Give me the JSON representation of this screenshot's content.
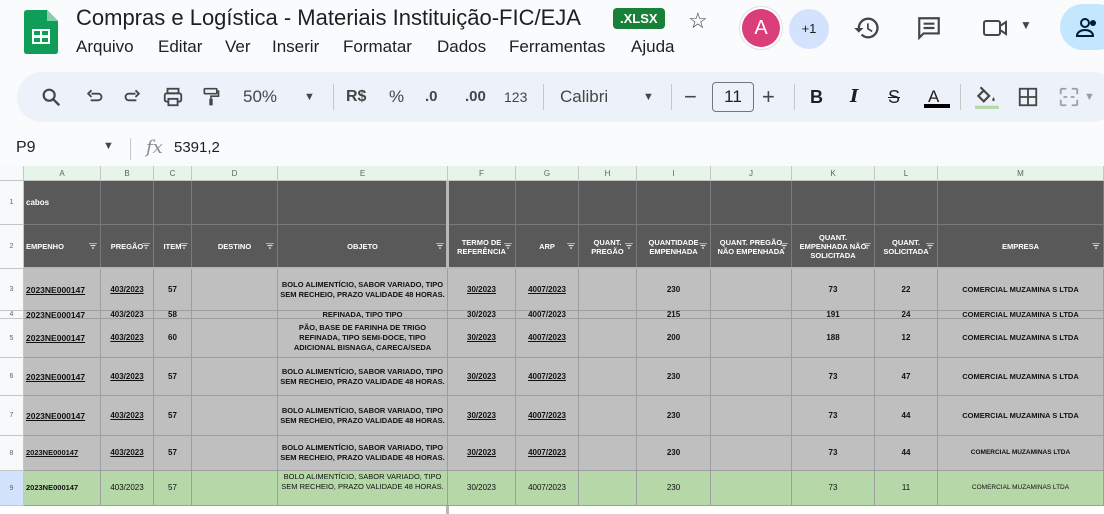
{
  "app": {
    "title": "Compras e Logística - Materiais Instituição-FIC/EJA",
    "badge": ".XLSX",
    "avatar_letter": "A",
    "collaborators": "+1",
    "brand_color": "#188038",
    "avatar_color": "#d93d7a"
  },
  "menu": [
    "Arquivo",
    "Editar",
    "Ver",
    "Inserir",
    "Formatar",
    "Dados",
    "Ferramentas",
    "Ajuda"
  ],
  "toolbar": {
    "zoom": "50%",
    "currency": "R$",
    "percent": "%",
    "decimal_decrease": ".0",
    "decimal_increase": ".00",
    "number_format": "123",
    "font": "Calibri",
    "font_size": "11",
    "icons": [
      "search-icon",
      "undo-icon",
      "redo-icon",
      "print-icon",
      "paint-format-icon",
      "bold-icon",
      "italic-icon",
      "strikethrough-icon",
      "text-color-icon",
      "fill-color-icon",
      "borders-icon",
      "merge-icon"
    ]
  },
  "formula_bar": {
    "cell_ref": "P9",
    "value": "5391,2"
  },
  "sheet": {
    "columns": [
      "A",
      "B",
      "C",
      "D",
      "E",
      "F",
      "G",
      "H",
      "I",
      "J",
      "K",
      "L",
      "M"
    ],
    "row1_label": "cabos",
    "headers": [
      "EMPENHO",
      "PREGÃO",
      "ITEM",
      "DESTINO",
      "OBJETO",
      "TERMO DE REFERÊNCIA",
      "ARP",
      "QUANT. PREGÃO",
      "QUANTIDADE EMPENHADA",
      "QUANT. PREGÃO NÃO EMPENHADA",
      "QUANT. EMPENHADA NÃO SOLICITADA",
      "QUANT. SOLICITADA",
      "EMPRESA"
    ],
    "rows": [
      {
        "num": "3",
        "empenho": "2023NE000147",
        "pregao": "403/2023",
        "item": "57",
        "destino": "",
        "objeto": "BOLO ALIMENTÍCIO, SABOR VARIADO, TIPO SEM RECHEIO, PRAZO VALIDADE 48 HORAS.",
        "termo": "30/2023",
        "arp": "4007/2023",
        "qpregao": "",
        "qemp": "230",
        "qnaoemp": "",
        "qempnaosol": "73",
        "qsol": "22",
        "empresa": "COMERCIAL MUZAMINA S LTDA"
      },
      {
        "num": "4",
        "empenho": "2023NE000147",
        "pregao": "403/2023",
        "item": "58",
        "destino": "",
        "objeto": "PÃO, BASE DE FARINHA DE TRIGO REFINADA, TIPO TIPO FRANÇÊS/BRANCO/DE SAL",
        "termo": "30/2023",
        "arp": "4007/2023",
        "qpregao": "",
        "qemp": "215",
        "qnaoemp": "",
        "qempnaosol": "191",
        "qsol": "24",
        "empresa": "COMERCIAL MUZAMINA S LTDA"
      },
      {
        "num": "5",
        "empenho": "2023NE000147",
        "pregao": "403/2023",
        "item": "60",
        "destino": "",
        "objeto": "PÃO, BASE DE FARINHA DE TRIGO REFINADA, TIPO SEMI-DOCE, TIPO ADICIONAL BISNAGA, CARECA/SEDA",
        "termo": "30/2023",
        "arp": "4007/2023",
        "qpregao": "",
        "qemp": "200",
        "qnaoemp": "",
        "qempnaosol": "188",
        "qsol": "12",
        "empresa": "COMERCIAL MUZAMINA S LTDA"
      },
      {
        "num": "6",
        "empenho": "2023NE000147",
        "pregao": "403/2023",
        "item": "57",
        "destino": "",
        "objeto": "BOLO ALIMENTÍCIO, SABOR VARIADO, TIPO SEM RECHEIO, PRAZO VALIDADE 48 HORAS.",
        "termo": "30/2023",
        "arp": "4007/2023",
        "qpregao": "",
        "qemp": "230",
        "qnaoemp": "",
        "qempnaosol": "73",
        "qsol": "47",
        "empresa": "COMERCIAL MUZAMINA S LTDA"
      },
      {
        "num": "7",
        "empenho": "2023NE000147",
        "pregao": "403/2023",
        "item": "57",
        "destino": "",
        "objeto": "BOLO ALIMENTÍCIO, SABOR VARIADO, TIPO SEM RECHEIO, PRAZO VALIDADE 48 HORAS.",
        "termo": "30/2023",
        "arp": "4007/2023",
        "qpregao": "",
        "qemp": "230",
        "qnaoemp": "",
        "qempnaosol": "73",
        "qsol": "44",
        "empresa": "COMERCIAL MUZAMINA S LTDA"
      },
      {
        "num": "8",
        "empenho": "2023NE000147",
        "pregao": "403/2023",
        "item": "57",
        "destino": "",
        "objeto": "BOLO ALIMENTÍCIO, SABOR VARIADO, TIPO SEM RECHEIO, PRAZO VALIDADE 48 HORAS.",
        "termo": "30/2023",
        "arp": "4007/2023",
        "qpregao": "",
        "qemp": "230",
        "qnaoemp": "",
        "qempnaosol": "73",
        "qsol": "44",
        "empresa": "COMERCIAL MUZAMINAS LTDA"
      },
      {
        "num": "9",
        "empenho": "2023NE000147",
        "pregao": "403/2023",
        "item": "57",
        "destino": "",
        "objeto": "BOLO ALIMENTÍCIO, SABOR VARIADO, TIPO SEM RECHEIO, PRAZO VALIDADE 48 HORAS.",
        "termo": "30/2023",
        "arp": "4007/2023",
        "qpregao": "",
        "qemp": "230",
        "qnaoemp": "",
        "qempnaosol": "73",
        "qsol": "11",
        "empresa": "COMERCIAL MUZAMINAS LTDA"
      }
    ],
    "colors": {
      "header_bg": "#595959",
      "row_gray": "#bfbfbf",
      "row_green": "#b6d7a8",
      "colhead_bg": "#e6f4ea"
    }
  }
}
